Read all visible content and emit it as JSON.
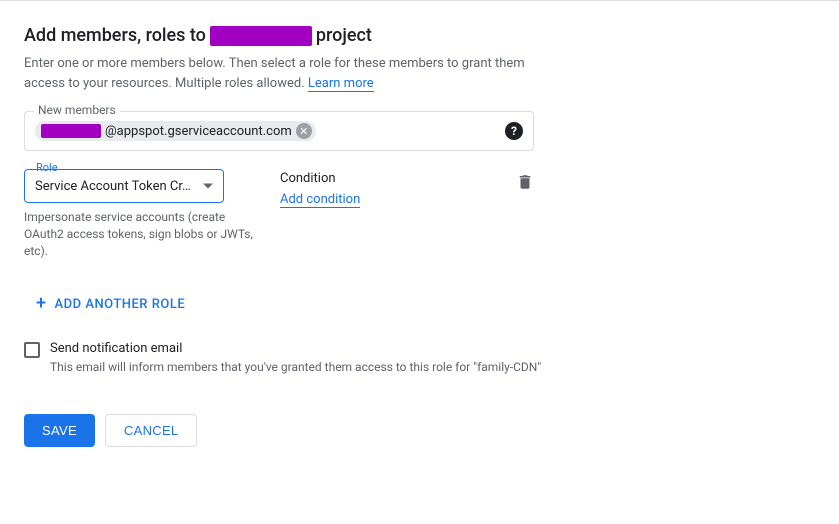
{
  "header": {
    "title_prefix": "Add members, roles to",
    "title_suffix": "project",
    "description_part1": "Enter one or more members below. Then select a role for these members to grant them access to your resources. Multiple roles allowed.",
    "learn_more": "Learn more"
  },
  "members": {
    "label": "New members",
    "chip_suffix": "@appspot.gserviceaccount.com"
  },
  "role": {
    "label": "Role",
    "selected": "Service Account Token Cr…",
    "description": "Impersonate service accounts (create OAuth2 access tokens, sign blobs or JWTs, etc)."
  },
  "condition": {
    "label": "Condition",
    "add_link": "Add condition"
  },
  "add_another_role": "ADD ANOTHER ROLE",
  "notification": {
    "label": "Send notification email",
    "sub": "This email will inform members that you've granted them access to this role for \"family-CDN\""
  },
  "buttons": {
    "save": "SAVE",
    "cancel": "CANCEL"
  }
}
